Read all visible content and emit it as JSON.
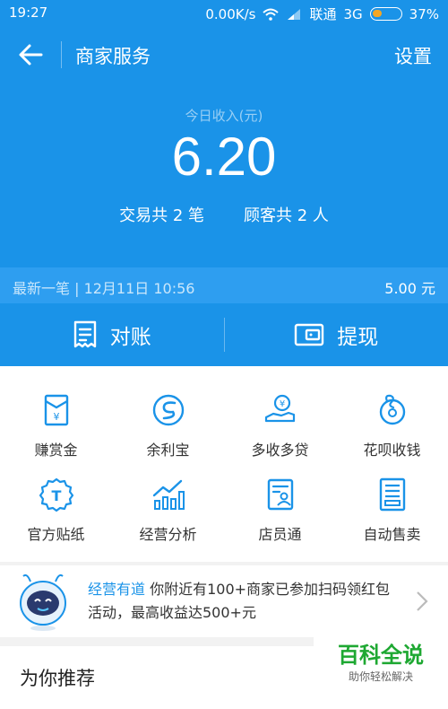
{
  "status_bar": {
    "time": "19:27",
    "speed": "0.00K/s",
    "carrier": "联通",
    "network": "3G",
    "battery": "37%",
    "battery_level": 0.37
  },
  "app_bar": {
    "title": "商家服务",
    "settings": "设置"
  },
  "income": {
    "label": "今日收入(元)",
    "amount": "6.20",
    "transactions": "交易共 2 笔",
    "customers": "顾客共 2 人"
  },
  "latest": {
    "text": "最新一笔 | 12月11日 10:56",
    "amount": "5.00 元"
  },
  "actions": [
    {
      "label": "对账",
      "icon": "receipt-icon"
    },
    {
      "label": "提现",
      "icon": "wallet-icon"
    }
  ],
  "services": [
    {
      "label": "赚赏金",
      "icon": "red-envelope-icon"
    },
    {
      "label": "余利宝",
      "icon": "yulibao-icon"
    },
    {
      "label": "多收多贷",
      "icon": "loan-hand-icon"
    },
    {
      "label": "花呗收钱",
      "icon": "huabei-icon"
    },
    {
      "label": "官方贴纸",
      "icon": "sticker-icon"
    },
    {
      "label": "经营分析",
      "icon": "chart-icon"
    },
    {
      "label": "店员通",
      "icon": "staff-icon"
    },
    {
      "label": "自动售卖",
      "icon": "vending-icon"
    }
  ],
  "banner": {
    "highlight": "经营有道",
    "text": "你附近有100+商家已参加扫码领红包活动，最高收益达500+元"
  },
  "recommend": {
    "title": "为你推荐"
  },
  "watermark": {
    "title": "百科全说",
    "subtitle": "助你轻松解决"
  },
  "colors": {
    "primary": "#1a93e8",
    "icon": "#1a93e8",
    "battery": "#f5a623",
    "watermark": "#1ea832"
  }
}
